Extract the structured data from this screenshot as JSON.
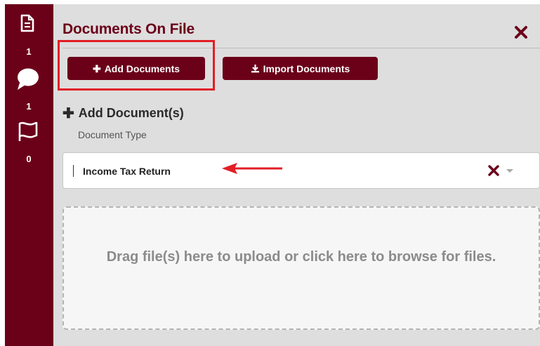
{
  "rail": {
    "documents_count": "1",
    "comments_count": "1",
    "flags_count": "0"
  },
  "panel": {
    "title": "Documents On File",
    "close_icon": "close-icon",
    "buttons": {
      "add_label": "Add Documents",
      "add_icon": "plus-icon",
      "import_label": "Import Documents",
      "import_icon": "download-icon"
    },
    "section_title": "Add Document(s)",
    "document_type_label": "Document Type",
    "document_type_value": "Income Tax Return",
    "dropzone_text": "Drag file(s) here to upload or click here to browse for files."
  },
  "annotations": {
    "highlight_color": "#e21e26",
    "arrow_color": "#e21e26"
  },
  "colors": {
    "brand": "#6b0019",
    "panel_bg": "#dedede"
  }
}
